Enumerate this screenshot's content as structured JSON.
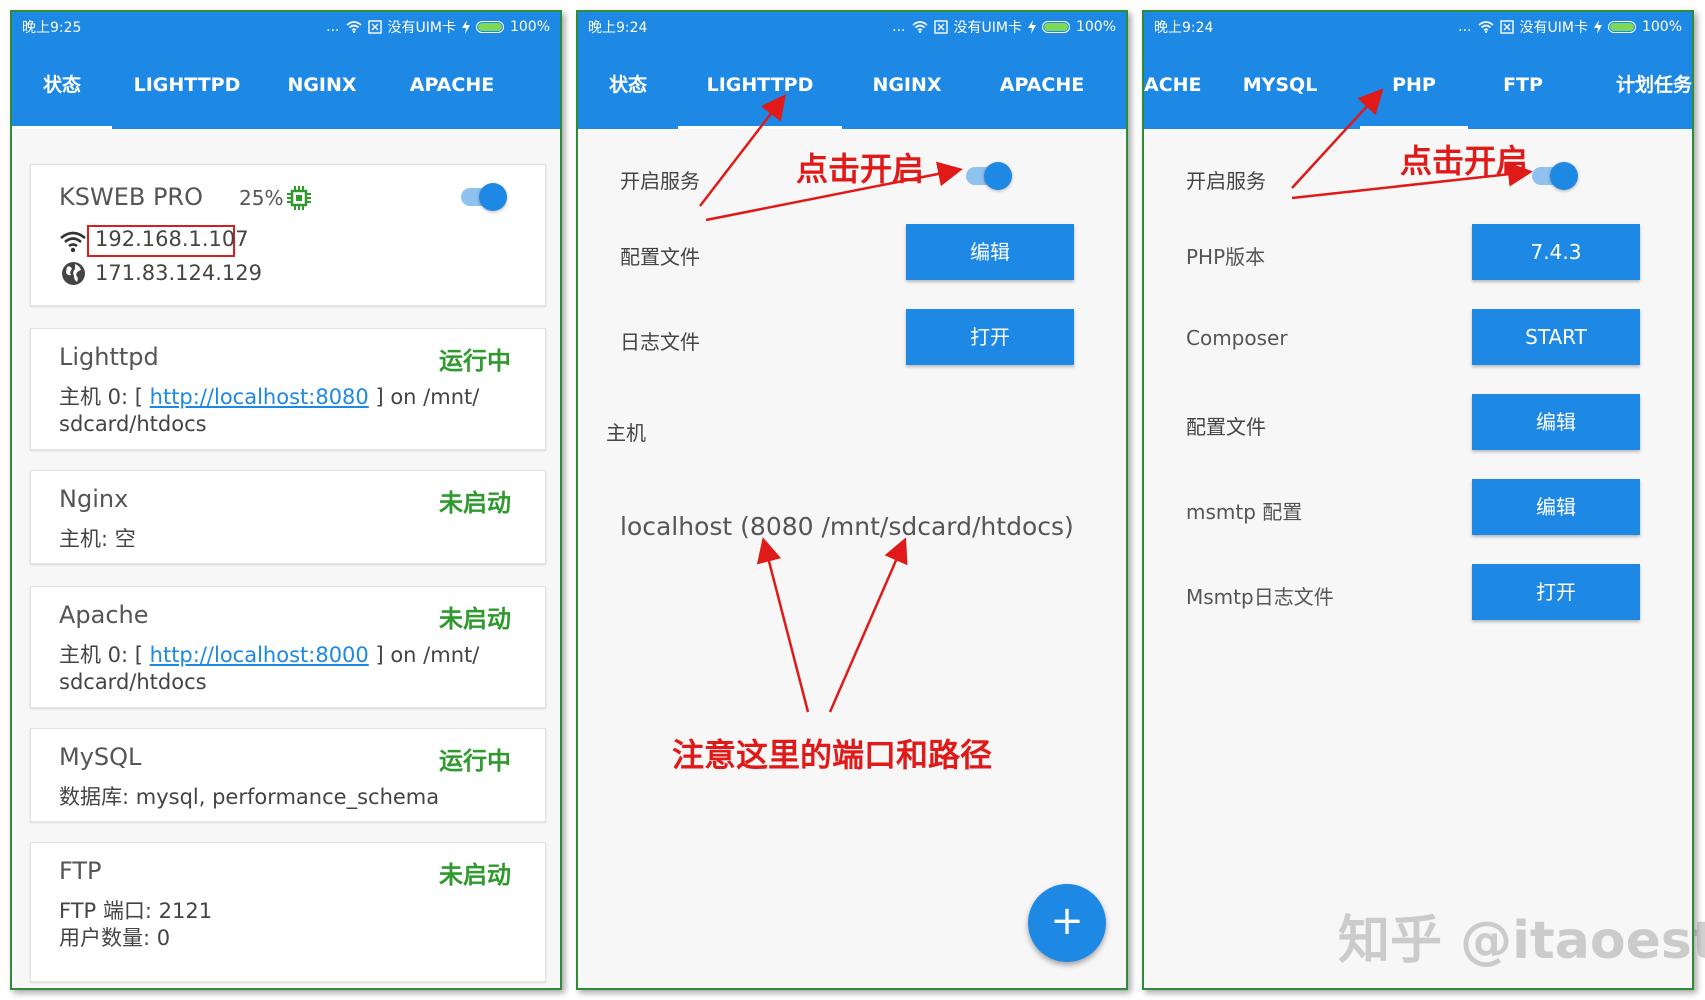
{
  "status_bar": {
    "p1_time": "晚上9:25",
    "p2_time": "晚上9:24",
    "p3_time": "晚上9:24",
    "dots": "...",
    "sim": "没有UIM卡",
    "battery": "100%"
  },
  "phone1": {
    "tabs": [
      "状态",
      "LIGHTTPD",
      "NGINX",
      "APACHE"
    ],
    "ksweb": {
      "title": "KSWEB PRO",
      "cpu": "25%",
      "local_ip": "192.168.1.107",
      "public_ip": "171.83.124.129"
    },
    "cards": [
      {
        "name": "Lighttpd",
        "status": "运行中",
        "prefix": "主机 0: [ ",
        "link": "http://localhost:8080",
        "suffix": " ] on /mnt/",
        "line2": "sdcard/htdocs"
      },
      {
        "name": "Nginx",
        "status": "未启动",
        "line1": "主机: 空"
      },
      {
        "name": "Apache",
        "status": "未启动",
        "prefix": "主机 0: [ ",
        "link": "http://localhost:8000",
        "suffix": " ] on /mnt/",
        "line2": "sdcard/htdocs"
      },
      {
        "name": "MySQL",
        "status": "运行中",
        "line1": "数据库: mysql, performance_schema"
      },
      {
        "name": "FTP",
        "status": "未启动",
        "line1": "FTP 端口: 2121",
        "line2": "用户数量: 0"
      }
    ]
  },
  "phone2": {
    "tabs": [
      "状态",
      "LIGHTTPD",
      "NGINX",
      "APACHE"
    ],
    "rows": {
      "service_label": "开启服务",
      "config_label": "配置文件",
      "config_button": "编辑",
      "log_label": "日志文件",
      "log_button": "打开"
    },
    "host_header": "主机",
    "host_entry": "localhost (8080 /mnt/sdcard/htdocs)",
    "fab": "+",
    "annotation_toggle": "点击开启",
    "annotation_port": "注意这里的端口和路径"
  },
  "phone3": {
    "tabs": [
      "ACHE",
      "MYSQL",
      "PHP",
      "FTP",
      "计划任务"
    ],
    "rows": {
      "service_label": "开启服务",
      "php_version_label": "PHP版本",
      "php_version_button": "7.4.3",
      "composer_label": "Composer",
      "composer_button": "START",
      "config_label": "配置文件",
      "config_button": "编辑",
      "msmtp_label": "msmtp 配置",
      "msmtp_button": "编辑",
      "msmtp_log_label": "Msmtp日志文件",
      "msmtp_log_button": "打开"
    },
    "annotation_toggle": "点击开启"
  },
  "watermark": "知乎 @itaoest",
  "colors": {
    "primary": "#1e88e5",
    "running": "#2e9a2e",
    "annotation": "#e01919",
    "frame": "#2e8b3a"
  },
  "icons": [
    "wifi-icon",
    "globe-icon",
    "cpu-icon",
    "sim-icon",
    "battery-icon",
    "lightning-icon",
    "plus-icon"
  ]
}
